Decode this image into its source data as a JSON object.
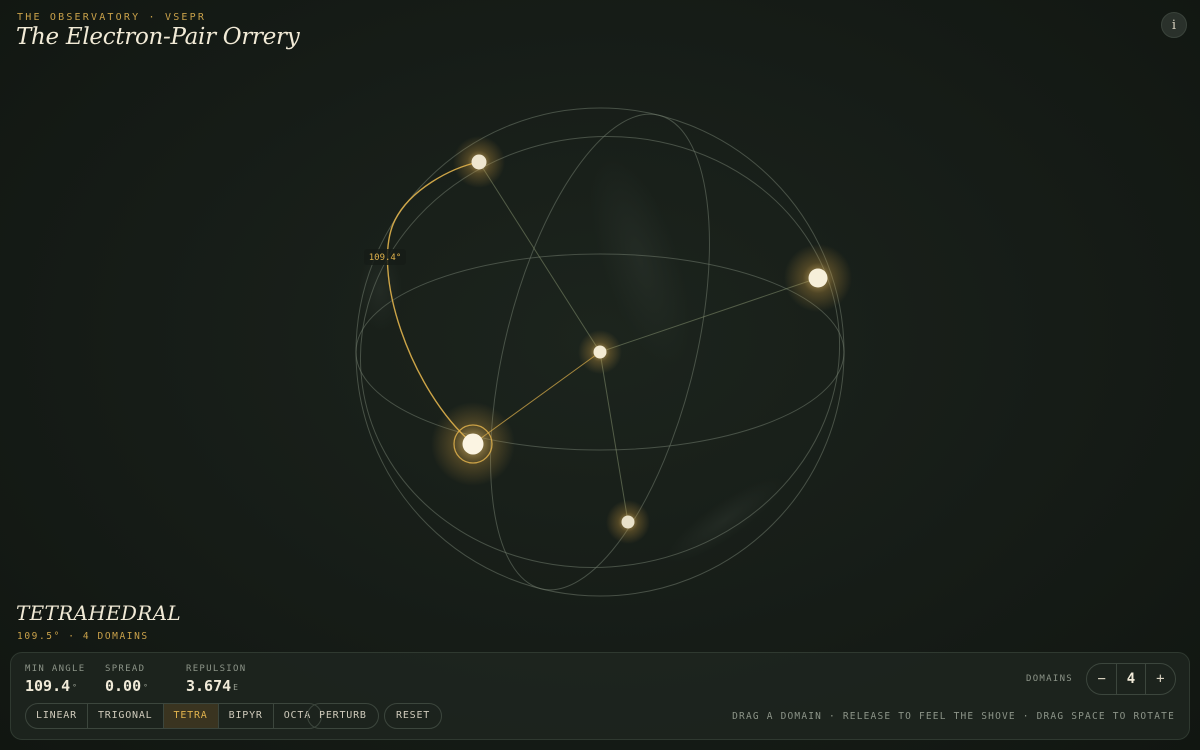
{
  "header": {
    "eyebrow": "THE OBSERVATORY · VSEPR",
    "title": "The Electron-Pair Orrery",
    "info_icon": "i"
  },
  "visualization": {
    "angle_label": "109.4°",
    "highlight_color": "#e0b24c",
    "glow_color": "#f5d58a"
  },
  "geometry": {
    "name": "TETRAHEDRAL",
    "subtitle": "109.5° · 4 DOMAINS"
  },
  "stats": {
    "min_angle": {
      "label": "MIN ANGLE",
      "value": "109.4",
      "unit": "°"
    },
    "spread": {
      "label": "SPREAD",
      "value": "0.00",
      "unit": "°"
    },
    "repulsion": {
      "label": "REPULSION",
      "value": "3.674",
      "unit": "E"
    }
  },
  "presets": [
    {
      "label": "LINEAR",
      "active": false
    },
    {
      "label": "TRIGONAL",
      "active": false
    },
    {
      "label": "TETRA",
      "active": true
    },
    {
      "label": "BIPYR",
      "active": false
    },
    {
      "label": "OCTA",
      "active": false
    }
  ],
  "actions": {
    "perturb": "PERTURB",
    "reset": "RESET"
  },
  "domains": {
    "label": "DOMAINS",
    "minus": "−",
    "value": "4",
    "plus": "+"
  },
  "hint": "DRAG A DOMAIN · RELEASE TO FEEL THE SHOVE · DRAG SPACE TO ROTATE"
}
